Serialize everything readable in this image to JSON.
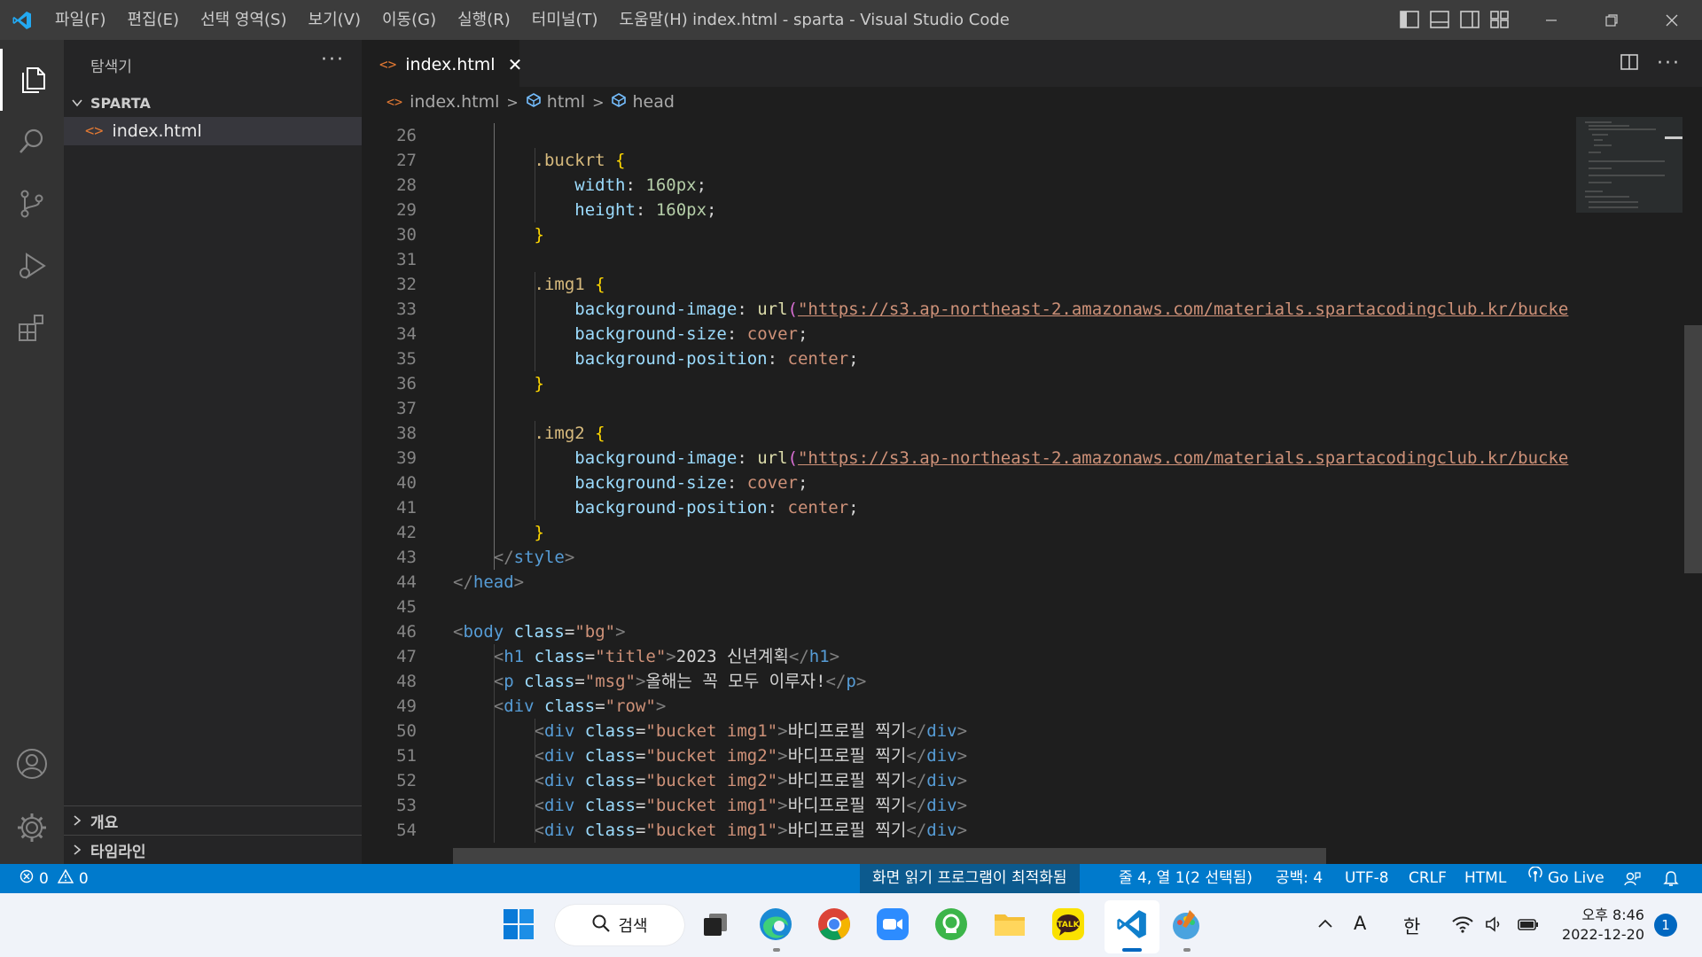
{
  "titlebar": {
    "menus": [
      "파일(F)",
      "편집(E)",
      "선택 영역(S)",
      "보기(V)",
      "이동(G)",
      "실행(R)",
      "터미널(T)",
      "도움말(H)"
    ],
    "title": "index.html - sparta - Visual Studio Code"
  },
  "sidebar": {
    "header": "탐색기",
    "folder": "SPARTA",
    "file": "index.html",
    "outline": "개요",
    "timeline": "타임라인"
  },
  "tab": {
    "label": "index.html",
    "close": "✕"
  },
  "breadcrumb": {
    "file": "index.html",
    "html": "html",
    "head": "head"
  },
  "code_lines": [
    {
      "n": "26",
      "t": ""
    },
    {
      "n": "27",
      "t": "        .buckrt {"
    },
    {
      "n": "28",
      "t": "            width: 160px;"
    },
    {
      "n": "29",
      "t": "            height: 160px;"
    },
    {
      "n": "30",
      "t": "        }"
    },
    {
      "n": "31",
      "t": ""
    },
    {
      "n": "32",
      "t": "        .img1 {"
    },
    {
      "n": "33",
      "t": "            background-image: url(\"https://s3.ap-northeast-2.amazonaws.com/materials.spartacodingclub.kr/bucke"
    },
    {
      "n": "34",
      "t": "            background-size: cover;"
    },
    {
      "n": "35",
      "t": "            background-position: center;"
    },
    {
      "n": "36",
      "t": "        }"
    },
    {
      "n": "37",
      "t": ""
    },
    {
      "n": "38",
      "t": "        .img2 {"
    },
    {
      "n": "39",
      "t": "            background-image: url(\"https://s3.ap-northeast-2.amazonaws.com/materials.spartacodingclub.kr/bucke"
    },
    {
      "n": "40",
      "t": "            background-size: cover;"
    },
    {
      "n": "41",
      "t": "            background-position: center;"
    },
    {
      "n": "42",
      "t": "        }"
    },
    {
      "n": "43",
      "t": "    </style>"
    },
    {
      "n": "44",
      "t": "</head>"
    },
    {
      "n": "45",
      "t": ""
    },
    {
      "n": "46",
      "t": "<body class=\"bg\">"
    },
    {
      "n": "47",
      "t": "    <h1 class=\"title\">2023 신년계획</h1>"
    },
    {
      "n": "48",
      "t": "    <p class=\"msg\">올해는 꼭 모두 이루자!</p>"
    },
    {
      "n": "49",
      "t": "    <div class=\"row\">"
    },
    {
      "n": "50",
      "t": "        <div class=\"bucket img1\">바디프로필 찍기</div>"
    },
    {
      "n": "51",
      "t": "        <div class=\"bucket img2\">바디프로필 찍기</div>"
    },
    {
      "n": "52",
      "t": "        <div class=\"bucket img2\">바디프로필 찍기</div>"
    },
    {
      "n": "53",
      "t": "        <div class=\"bucket img1\">바디프로필 찍기</div>"
    },
    {
      "n": "54",
      "t": "        <div class=\"bucket img1\">바디프로필 찍기</div>"
    }
  ],
  "statusbar": {
    "errors": "0",
    "warnings": "0",
    "screen_reader": "화면 읽기 프로그램이 최적화됨",
    "position": "줄 4, 열 1(2 선택됨)",
    "spaces": "공백: 4",
    "encoding": "UTF-8",
    "eol": "CRLF",
    "language": "HTML",
    "golive": "Go Live"
  },
  "taskbar": {
    "search": "검색",
    "ime_a": "A",
    "ime_han": "한",
    "time": "오후 8:46",
    "date": "2022-12-20",
    "notifications": "1"
  },
  "colors": {
    "keyword": "#d7ba7d",
    "property": "#9cdcfe",
    "number": "#b5cea8",
    "string": "#ce9178",
    "tag": "#569cd6",
    "brace": "#ffd700",
    "accent": "#007acc"
  }
}
